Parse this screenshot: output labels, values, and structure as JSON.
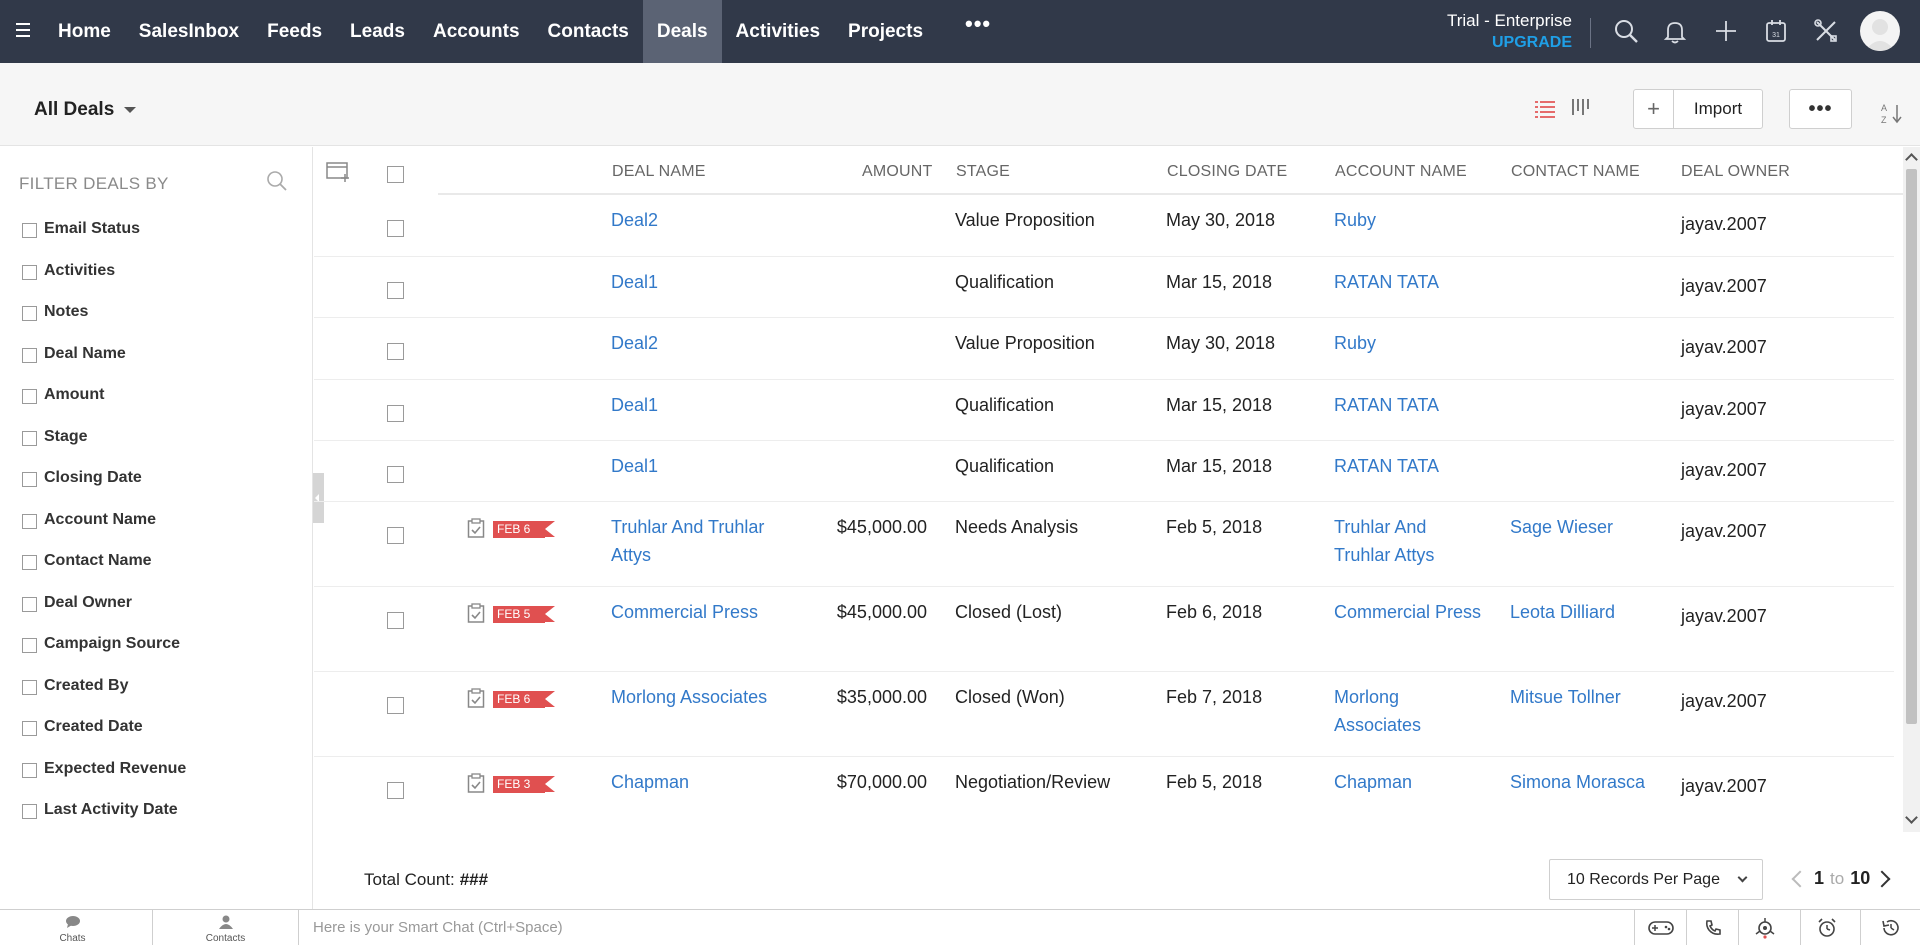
{
  "nav": {
    "items": [
      {
        "label": "Home",
        "active": false
      },
      {
        "label": "SalesInbox",
        "active": false
      },
      {
        "label": "Feeds",
        "active": false
      },
      {
        "label": "Leads",
        "active": false
      },
      {
        "label": "Accounts",
        "active": false
      },
      {
        "label": "Contacts",
        "active": false
      },
      {
        "label": "Deals",
        "active": true
      },
      {
        "label": "Activities",
        "active": false
      },
      {
        "label": "Projects",
        "active": false
      }
    ],
    "more": "•••",
    "trial_label": "Trial - Enterprise",
    "upgrade_label": "UPGRADE",
    "icons": [
      "search-icon",
      "bell-icon",
      "plus-icon",
      "calendar-icon",
      "tools-icon"
    ],
    "calendar_day": "31"
  },
  "toolbar": {
    "view_label": "All Deals",
    "import_label": "Import",
    "plus_label": "+",
    "more_label": "•••",
    "sort_label": "A Z"
  },
  "sidebar": {
    "title": "FILTER DEALS BY",
    "filters": [
      "Email Status",
      "Activities",
      "Notes",
      "Deal Name",
      "Amount",
      "Stage",
      "Closing Date",
      "Account Name",
      "Contact Name",
      "Deal Owner",
      "Campaign Source",
      "Created By",
      "Created Date",
      "Expected Revenue",
      "Last Activity Date"
    ]
  },
  "table": {
    "headers": {
      "deal_name": "DEAL NAME",
      "amount": "AMOUNT",
      "stage": "STAGE",
      "closing_date": "CLOSING DATE",
      "account_name": "ACCOUNT NAME",
      "contact_name": "CONTACT NAME",
      "deal_owner": "DEAL OWNER"
    },
    "rows": [
      {
        "deal_name": "Deal2",
        "amount": "",
        "stage": "Value Proposition",
        "closing_date": "May 30, 2018",
        "account_name": "Ruby",
        "contact_name": "",
        "deal_owner": "jayav.2007",
        "task": ""
      },
      {
        "deal_name": "Deal1",
        "amount": "",
        "stage": "Qualification",
        "closing_date": "Mar 15, 2018",
        "account_name": "RATAN TATA",
        "contact_name": "",
        "deal_owner": "jayav.2007",
        "task": ""
      },
      {
        "deal_name": "Deal2",
        "amount": "",
        "stage": "Value Proposition",
        "closing_date": "May 30, 2018",
        "account_name": "Ruby",
        "contact_name": "",
        "deal_owner": "jayav.2007",
        "task": ""
      },
      {
        "deal_name": "Deal1",
        "amount": "",
        "stage": "Qualification",
        "closing_date": "Mar 15, 2018",
        "account_name": "RATAN TATA",
        "contact_name": "",
        "deal_owner": "jayav.2007",
        "task": ""
      },
      {
        "deal_name": "Deal1",
        "amount": "",
        "stage": "Qualification",
        "closing_date": "Mar 15, 2018",
        "account_name": "RATAN TATA",
        "contact_name": "",
        "deal_owner": "jayav.2007",
        "task": ""
      },
      {
        "deal_name": "Truhlar And Truhlar Attys",
        "amount": "$45,000.00",
        "stage": "Needs Analysis",
        "closing_date": "Feb 5, 2018",
        "account_name": "Truhlar And Truhlar Attys",
        "contact_name": "Sage Wieser",
        "deal_owner": "jayav.2007",
        "task": "FEB 6"
      },
      {
        "deal_name": "Commercial Press",
        "amount": "$45,000.00",
        "stage": "Closed (Lost)",
        "closing_date": "Feb 6, 2018",
        "account_name": "Commercial Press",
        "contact_name": "Leota Dilliard",
        "deal_owner": "jayav.2007",
        "task": "FEB 5"
      },
      {
        "deal_name": "Morlong Associates",
        "amount": "$35,000.00",
        "stage": "Closed (Won)",
        "closing_date": "Feb 7, 2018",
        "account_name": "Morlong Associates",
        "contact_name": "Mitsue Tollner",
        "deal_owner": "jayav.2007",
        "task": "FEB 6"
      },
      {
        "deal_name": "Chapman",
        "amount": "$70,000.00",
        "stage": "Negotiation/Review",
        "closing_date": "Feb 5, 2018",
        "account_name": "Chapman",
        "contact_name": "Simona Morasca",
        "deal_owner": "jayav.2007",
        "task": "FEB 3"
      }
    ]
  },
  "footer": {
    "total_label": "Total Count:",
    "total_value": "###",
    "per_page": "10 Records Per Page",
    "page_from": "1",
    "page_to_label": "to",
    "page_to": "10"
  },
  "bottom": {
    "chats_label": "Chats",
    "contacts_label": "Contacts",
    "chat_placeholder": "Here is your Smart Chat (Ctrl+Space)"
  },
  "colors": {
    "topbar": "#313949",
    "active_tab": "#5b6374",
    "upgrade": "#1f9fe6",
    "link": "#3279c9",
    "task_flag": "#e05050"
  }
}
